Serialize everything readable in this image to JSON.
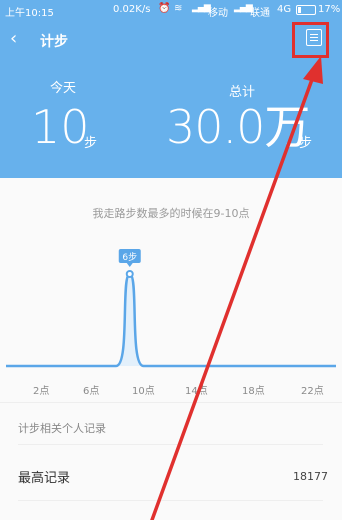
{
  "status_bar": {
    "time": "上午10:15",
    "network_speed": "0.02K/s",
    "carrier1": "移动",
    "carrier2": "联通",
    "network_type": "4G",
    "battery": "17%"
  },
  "header": {
    "title": "计步",
    "today_label": "今天",
    "today_value": "10",
    "today_unit": "步",
    "total_label": "总计",
    "total_value": "30.0万",
    "total_unit": "步"
  },
  "chart": {
    "peak_text": "我走路步数最多的时候在9-10点",
    "peak_label": "6步",
    "x_labels": [
      "2点",
      "6点",
      "10点",
      "14点",
      "18点",
      "22点"
    ]
  },
  "chart_data": {
    "type": "area",
    "x": [
      0,
      6,
      7,
      8,
      9,
      10,
      11,
      24
    ],
    "values": [
      0,
      0,
      0,
      0,
      6,
      0,
      0,
      0
    ],
    "peak_label": "6步",
    "x_tick_labels": [
      "2点",
      "6点",
      "10点",
      "14点",
      "18点",
      "22点"
    ]
  },
  "records": {
    "section_title": "计步相关个人记录",
    "best_label": "最高记录",
    "best_value": "18177"
  },
  "colors": {
    "header_bg": "#67b1ec",
    "highlight": "#e0302e",
    "chart_line": "#5aa6e8"
  }
}
